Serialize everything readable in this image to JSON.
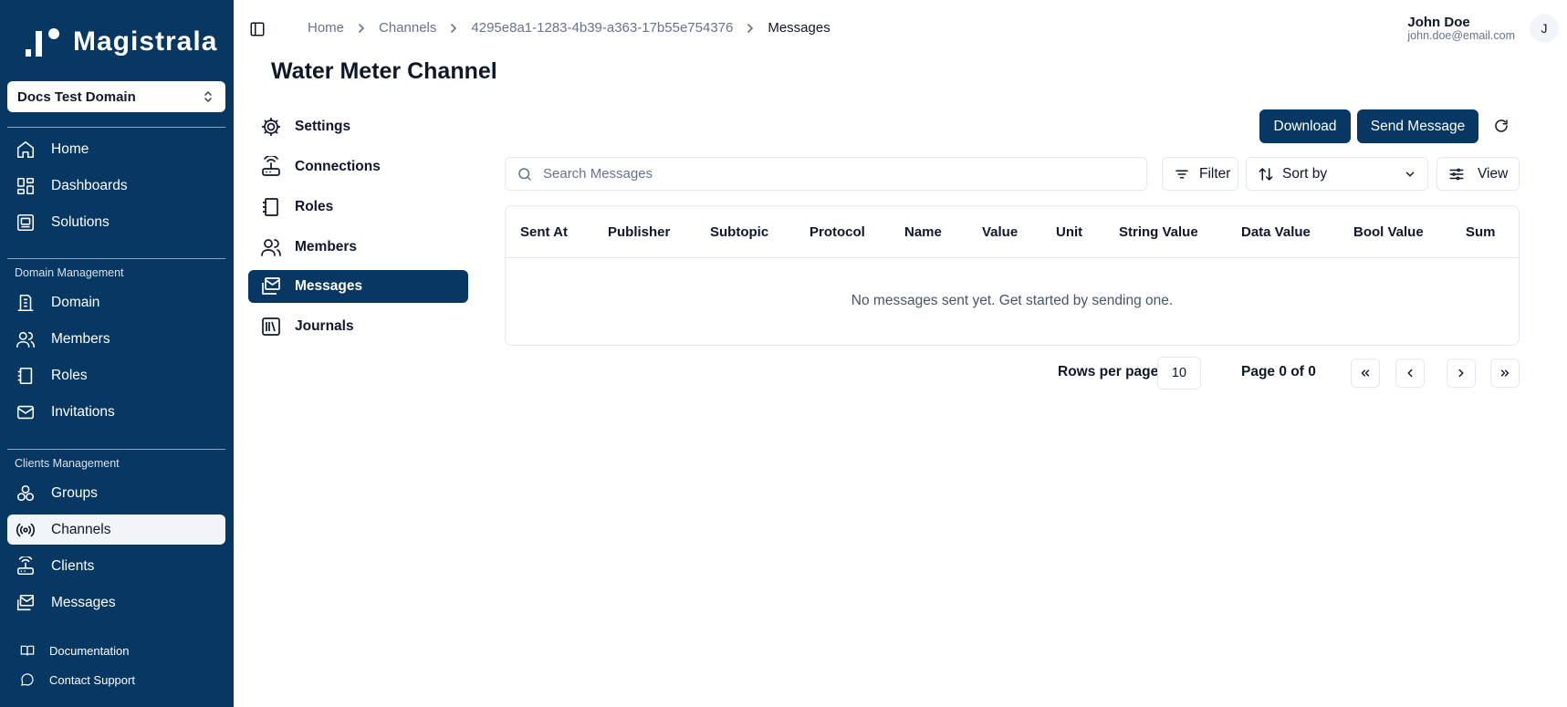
{
  "app": {
    "name": "Magistrala"
  },
  "domain_selector": {
    "value": "Docs Test Domain"
  },
  "sidebar": {
    "main_items": [
      {
        "label": "Home",
        "icon": "home-icon"
      },
      {
        "label": "Dashboards",
        "icon": "dashboard-icon"
      },
      {
        "label": "Solutions",
        "icon": "solutions-icon"
      }
    ],
    "domain_section": {
      "title": "Domain Management",
      "items": [
        {
          "label": "Domain",
          "icon": "building-icon"
        },
        {
          "label": "Members",
          "icon": "users-icon"
        },
        {
          "label": "Roles",
          "icon": "notebook-icon"
        },
        {
          "label": "Invitations",
          "icon": "mail-icon"
        }
      ]
    },
    "clients_section": {
      "title": "Clients Management",
      "items": [
        {
          "label": "Groups",
          "icon": "groups-icon"
        },
        {
          "label": "Channels",
          "icon": "broadcast-icon",
          "active": true
        },
        {
          "label": "Clients",
          "icon": "router-icon"
        },
        {
          "label": "Messages",
          "icon": "mailbox-icon"
        }
      ]
    },
    "footer": [
      {
        "label": "Documentation",
        "icon": "book-icon"
      },
      {
        "label": "Contact Support",
        "icon": "chat-icon"
      }
    ]
  },
  "breadcrumb": [
    "Home",
    "Channels",
    "4295e8a1-1283-4b39-a363-17b55e754376",
    "Messages"
  ],
  "user": {
    "name": "John Doe",
    "email": "john.doe@email.com",
    "initial": "J"
  },
  "page": {
    "title": "Water Meter Channel"
  },
  "subnav": [
    {
      "label": "Settings",
      "icon": "gear-icon"
    },
    {
      "label": "Connections",
      "icon": "router-icon"
    },
    {
      "label": "Roles",
      "icon": "notebook-icon"
    },
    {
      "label": "Members",
      "icon": "users-icon"
    },
    {
      "label": "Messages",
      "icon": "mailbox-icon",
      "active": true
    },
    {
      "label": "Journals",
      "icon": "library-icon"
    }
  ],
  "toolbar": {
    "download_label": "Download",
    "send_label": "Send Message",
    "search_placeholder": "Search Messages",
    "filter_label": "Filter",
    "sort_label": "Sort by",
    "view_label": "View"
  },
  "table": {
    "columns": [
      "Sent At",
      "Publisher",
      "Subtopic",
      "Protocol",
      "Name",
      "Value",
      "Unit",
      "String Value",
      "Data Value",
      "Bool Value",
      "Sum"
    ],
    "empty_message": "No messages sent yet. Get started by sending one."
  },
  "pagination": {
    "rows_label": "Rows per page",
    "rows_value": "10",
    "page_info": "Page 0 of 0"
  },
  "colors": {
    "primary": "#073763",
    "border": "#e2e8f0",
    "muted": "#64748b"
  }
}
